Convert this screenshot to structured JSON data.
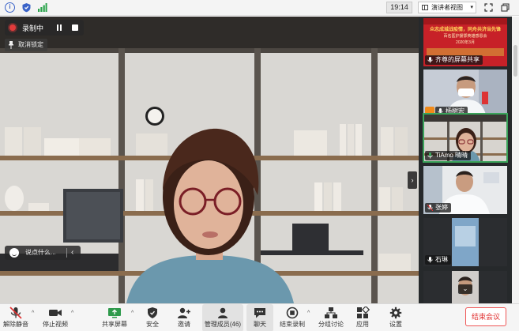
{
  "topbar": {
    "icons": [
      "info-icon",
      "shield-icon",
      "signal-icon"
    ],
    "time": "19:14",
    "view_mode": "演讲者视图",
    "window_icons": [
      "fullscreen-icon",
      "restore-icon"
    ]
  },
  "recording": {
    "label": "录制中",
    "controls": [
      "pause-icon",
      "stop-icon"
    ]
  },
  "main_video": {
    "unpin_label": "取消锁定",
    "chat_placeholder": "说点什么..."
  },
  "participants": [
    {
      "name": "齐尊的屏幕共享",
      "mic": "unmuted",
      "active": false
    },
    {
      "name": "杨树宏",
      "mic": "unmuted",
      "active": false
    },
    {
      "name": "TiAmo 晴晴",
      "mic": "unmuted",
      "active": true
    },
    {
      "name": "张婷",
      "mic": "muted",
      "active": false
    },
    {
      "name": "石琳",
      "mic": "unmuted",
      "active": false
    },
    {
      "name": "",
      "mic": "",
      "active": false
    }
  ],
  "share_tile": {
    "line1": "众志成城战疫情，同舟共济当先锋",
    "line2": "百名医护援鄂英雄感恩会",
    "line3": "2020年3月"
  },
  "toolbar": {
    "unmute": "解除静音",
    "stop_video": "停止视频",
    "share_screen": "共享屏幕",
    "security": "安全",
    "invite": "邀请",
    "participants": "管理成员(46)",
    "chat": "聊天",
    "end_recording": "结束录制",
    "breakout": "分组讨论",
    "apps": "应用",
    "settings": "设置",
    "end_meeting": "结束会议"
  },
  "colors": {
    "record_red": "#e23b3b",
    "end_meeting_red": "#e03030",
    "active_speaker_green": "#3aa35a",
    "panel_bg": "#26292b"
  }
}
